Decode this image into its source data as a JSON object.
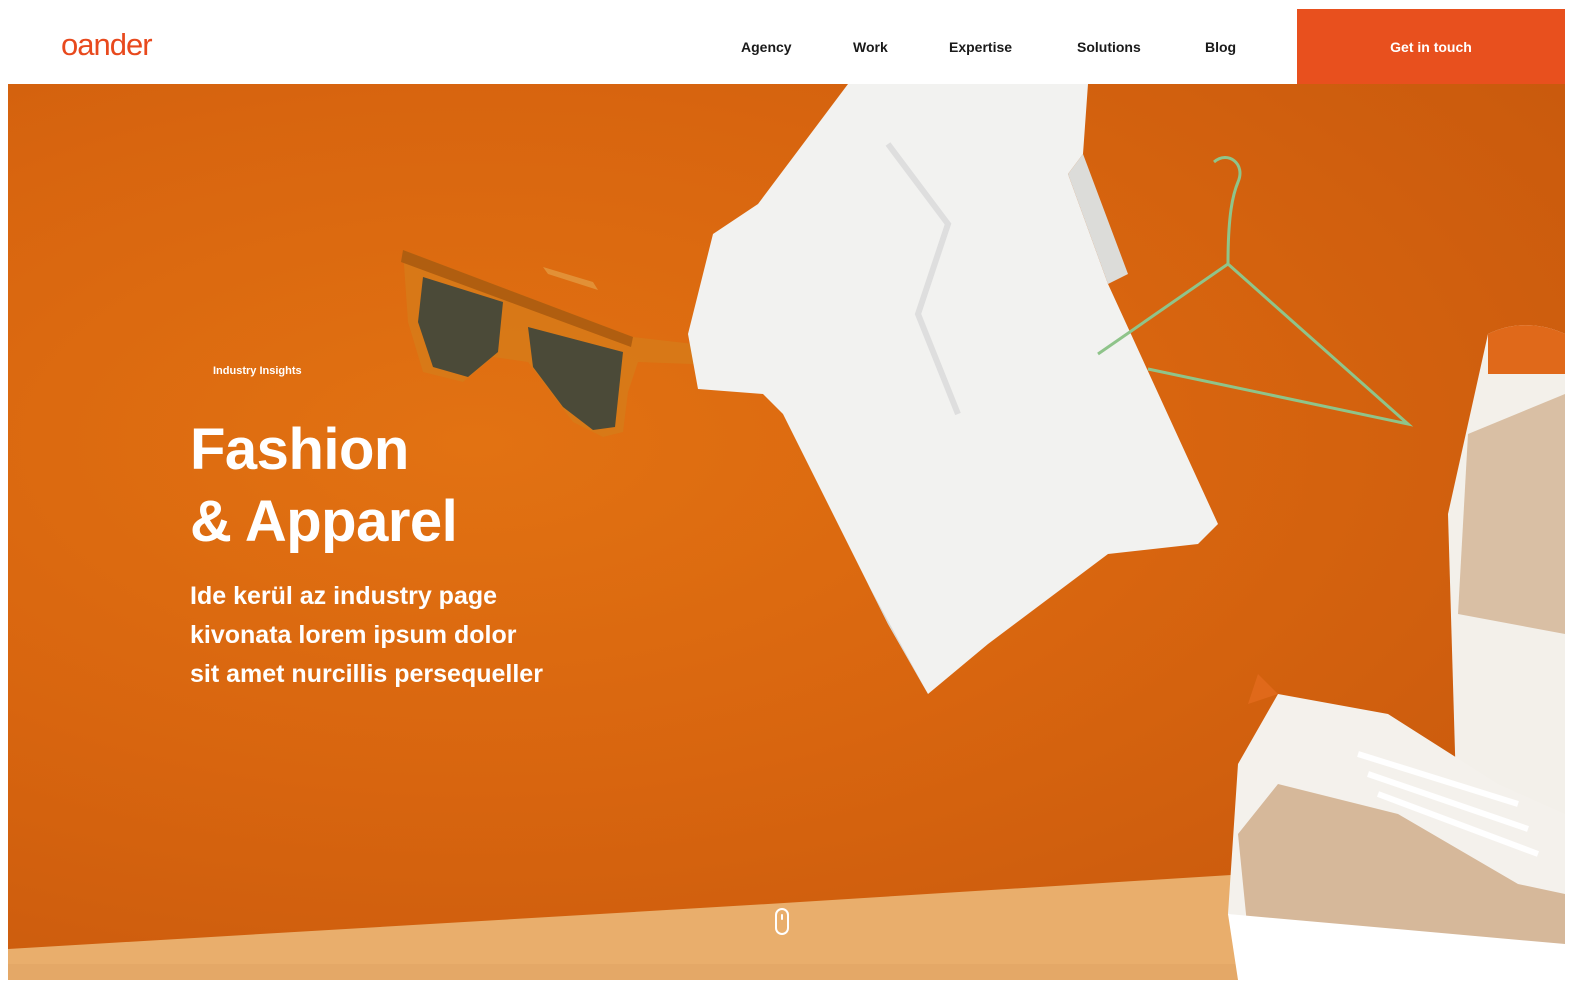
{
  "header": {
    "logo": "oander",
    "nav": [
      "Agency",
      "Work",
      "Expertise",
      "Solutions",
      "Blog"
    ],
    "cta_label": "Get in touch"
  },
  "hero": {
    "eyebrow": "Industry Insights",
    "title_line1": "Fashion",
    "title_line2": "& Apparel",
    "subtitle_line1": "Ide kerül az industry page",
    "subtitle_line2": "kivonata lorem ipsum dolor",
    "subtitle_line3": "sit amet nurcillis persequeller"
  },
  "icons": [
    "sunglasses-image",
    "tshirt-image",
    "hanger-image",
    "sneaker-image",
    "scroll-mouse-icon"
  ],
  "colors": {
    "accent": "#e8501e",
    "hero_bg": "#d8650f",
    "floor": "#e8b070",
    "text_dark": "#1a1a1a"
  }
}
